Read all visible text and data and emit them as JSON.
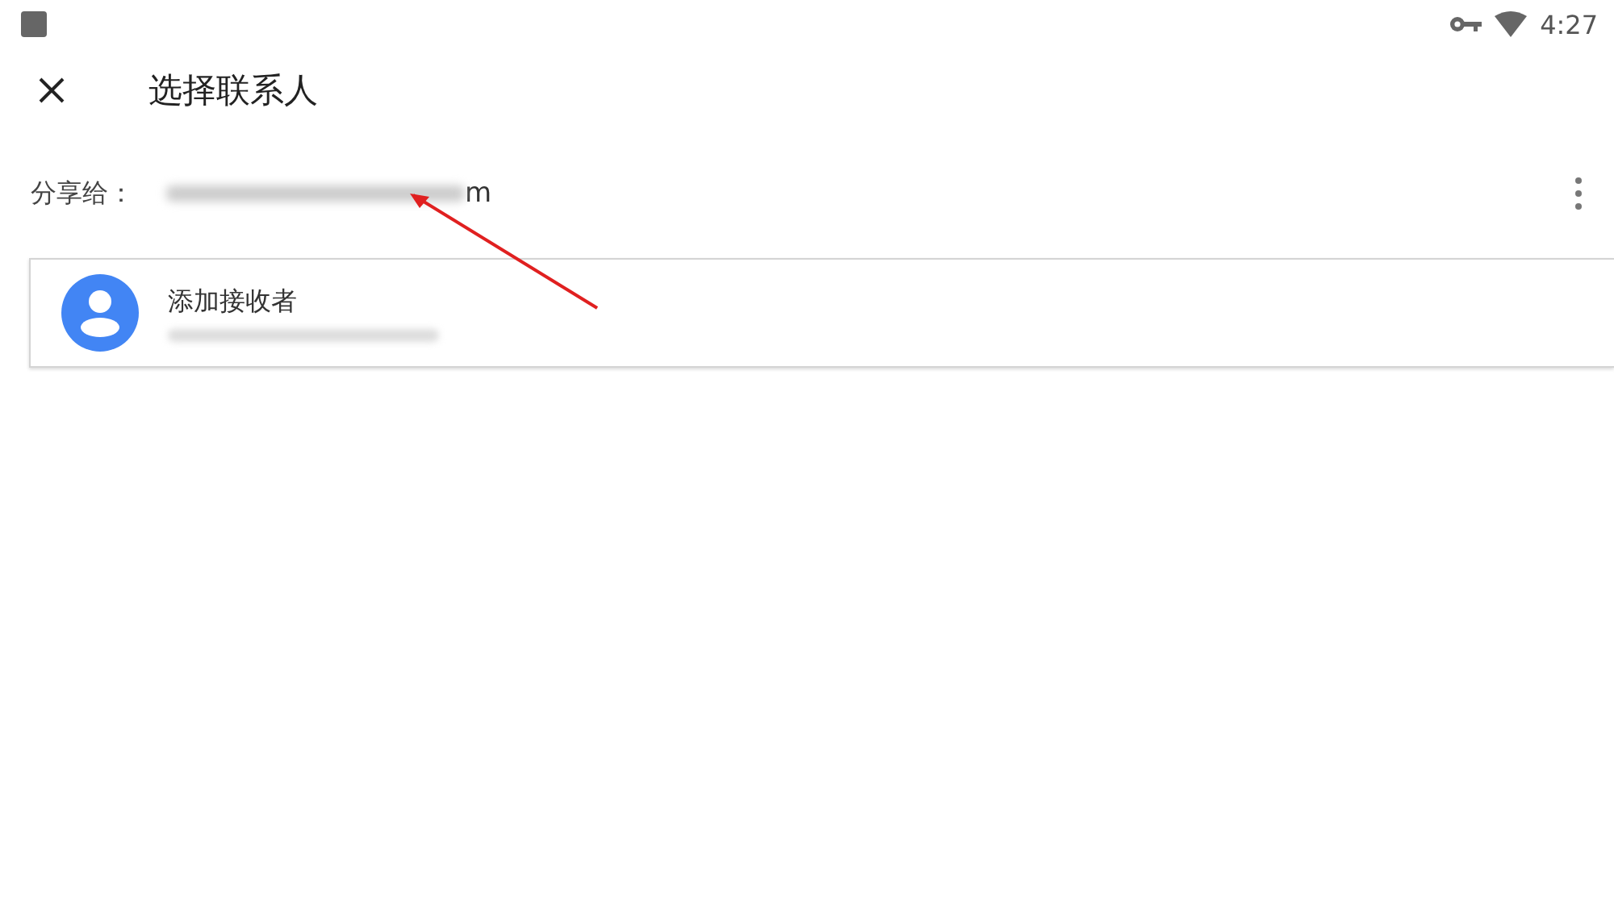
{
  "status_bar": {
    "time": "4:27"
  },
  "app_bar": {
    "title": "选择联系人"
  },
  "share_field": {
    "label": "分享给：",
    "value_tail": "m"
  },
  "suggestion": {
    "title": "添加接收者"
  }
}
